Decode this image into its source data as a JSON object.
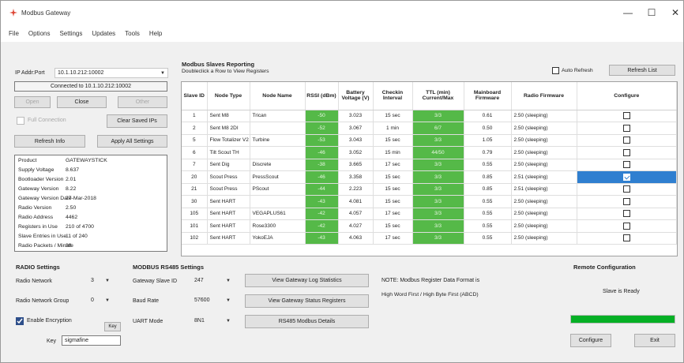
{
  "window": {
    "title": "Modbus Gateway",
    "minimize": "—",
    "maximize": "☐",
    "close": "✕"
  },
  "menu": [
    "File",
    "Options",
    "Settings",
    "Updates",
    "Tools",
    "Help"
  ],
  "connection": {
    "ip_label": "IP Addr:Port",
    "ip_value": "10.1.10.212:10002",
    "status": "Connected to 10.1.10.212:10002",
    "btn_open": "Open",
    "btn_close": "Close",
    "btn_other": "Other",
    "full_connection_label": "Full Connection",
    "btn_clear_ips": "Clear Saved IPs",
    "btn_refresh_info": "Refresh Info",
    "btn_apply_all": "Apply All Settings"
  },
  "info": [
    {
      "label": "Product",
      "value": "GATEWAYSTICK"
    },
    {
      "label": "Supply Voltage",
      "value": "8.637"
    },
    {
      "label": "Bootloader Version",
      "value": "2.01"
    },
    {
      "label": "Gateway Version",
      "value": "8.22"
    },
    {
      "label": "Gateway Version Date",
      "value": "27-Mar-2018"
    },
    {
      "label": "Radio Version",
      "value": "2.50"
    },
    {
      "label": "Radio Address",
      "value": "4462"
    },
    {
      "label": "Registers in Use",
      "value": "210 of 4700"
    },
    {
      "label": "Slave Entries in Use",
      "value": "11 of 240"
    },
    {
      "label": "Radio Packets / Minute",
      "value": "38"
    }
  ],
  "slaves": {
    "title": "Modbus Slaves Reporting",
    "subtitle": "Doubleclick a Row to View Registers",
    "auto_refresh_label": "Auto Refresh",
    "btn_refresh_list": "Refresh List",
    "columns": [
      "Slave ID",
      "Node Type",
      "Node Name",
      "RSSI (dBm)",
      "Battery Voltage (V)",
      "Checkin Interval",
      "TTL (min) Current/Max",
      "Mainboard Firmware",
      "Radio Firmware",
      "Configure"
    ],
    "rows": [
      {
        "id": "1",
        "type": "Sent M8",
        "name": "Trican",
        "rssi": "-50",
        "batt": "3.023",
        "checkin": "15 sec",
        "ttl": "3/3",
        "mb_fw": "0.61",
        "radio_fw": "2.50 (sleeping)",
        "configure": false
      },
      {
        "id": "2",
        "type": "Sent M8 2DI",
        "name": "",
        "rssi": "-52",
        "batt": "3.067",
        "checkin": "1 min",
        "ttl": "6/7",
        "mb_fw": "0.50",
        "radio_fw": "2.50 (sleeping)",
        "configure": false
      },
      {
        "id": "5",
        "type": "Flow Totalizer V2",
        "name": "Turbine",
        "rssi": "-53",
        "batt": "3.043",
        "checkin": "15 sec",
        "ttl": "3/3",
        "mb_fw": "1.05",
        "radio_fw": "2.50 (sleeping)",
        "configure": false
      },
      {
        "id": "6",
        "type": "Tilt Scout TH",
        "name": "",
        "rssi": "-46",
        "batt": "3.052",
        "checkin": "15 min",
        "ttl": "44/50",
        "mb_fw": "0.79",
        "radio_fw": "2.50 (sleeping)",
        "configure": false
      },
      {
        "id": "7",
        "type": "Sent Dig",
        "name": "Discrete",
        "rssi": "-38",
        "batt": "3.665",
        "checkin": "17 sec",
        "ttl": "3/3",
        "mb_fw": "0.55",
        "radio_fw": "2.50 (sleeping)",
        "configure": false
      },
      {
        "id": "20",
        "type": "Scout Press",
        "name": "PressScout",
        "rssi": "-46",
        "batt": "3.358",
        "checkin": "15 sec",
        "ttl": "3/3",
        "mb_fw": "0.85",
        "radio_fw": "2.51 (sleeping)",
        "configure": true
      },
      {
        "id": "21",
        "type": "Scout Press",
        "name": "PScout",
        "rssi": "-44",
        "batt": "2.223",
        "checkin": "15 sec",
        "ttl": "3/3",
        "mb_fw": "0.85",
        "radio_fw": "2.51 (sleeping)",
        "configure": false
      },
      {
        "id": "30",
        "type": "Sent HART",
        "name": "",
        "rssi": "-43",
        "batt": "4.081",
        "checkin": "15 sec",
        "ttl": "3/3",
        "mb_fw": "0.55",
        "radio_fw": "2.50 (sleeping)",
        "configure": false
      },
      {
        "id": "105",
        "type": "Sent HART",
        "name": "VEGAPLUS61",
        "rssi": "-42",
        "batt": "4.057",
        "checkin": "17 sec",
        "ttl": "3/3",
        "mb_fw": "0.55",
        "radio_fw": "2.50 (sleeping)",
        "configure": false
      },
      {
        "id": "101",
        "type": "Sent HART",
        "name": "Rose3300",
        "rssi": "-42",
        "batt": "4.027",
        "checkin": "15 sec",
        "ttl": "3/3",
        "mb_fw": "0.55",
        "radio_fw": "2.50 (sleeping)",
        "configure": false
      },
      {
        "id": "102",
        "type": "Sent HART",
        "name": "YokoEJA",
        "rssi": "-43",
        "batt": "4.063",
        "checkin": "17 sec",
        "ttl": "3/3",
        "mb_fw": "0.55",
        "radio_fw": "2.50 (sleeping)",
        "configure": false
      }
    ]
  },
  "radio": {
    "title": "RADIO Settings",
    "network_label": "Radio Network",
    "network_value": "3",
    "group_label": "Radio Network Group",
    "group_value": "0",
    "encryption_label": "Enable Encryption",
    "btn_key": "Key",
    "key_label": "Key",
    "key_value": "sigmafine"
  },
  "rs485": {
    "title": "MODBUS RS485 Settings",
    "slave_id_label": "Gateway Slave ID",
    "slave_id_value": "247",
    "baud_label": "Baud Rate",
    "baud_value": "57600",
    "uart_label": "UART Mode",
    "uart_value": "8N1",
    "btn_log": "View Gateway Log Statistics",
    "btn_status": "View Gateway Status Registers",
    "btn_details": "RS485 Modbus Details",
    "note1": "NOTE: Modbus Register Data Format is",
    "note2": "High Word First / High Byte First (ABCD)"
  },
  "remote": {
    "title": "Remote Configuration",
    "status": "Slave is Ready",
    "progress": 1.0,
    "btn_configure": "Configure",
    "btn_exit": "Exit"
  }
}
